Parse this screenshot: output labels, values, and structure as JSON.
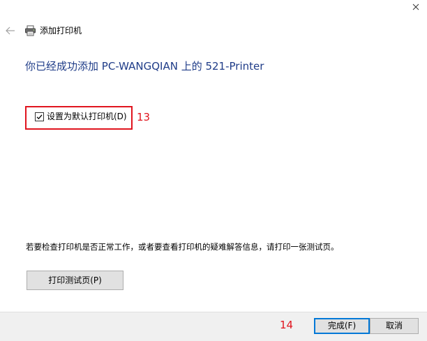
{
  "window": {
    "close_icon": "close-icon"
  },
  "header": {
    "back_icon": "back-arrow-icon",
    "printer_icon": "printer-icon",
    "title": "添加打印机"
  },
  "main": {
    "success_heading": "你已经成功添加 PC-WANGQIAN 上的 521-Printer",
    "default_printer_checkbox": {
      "label": "设置为默认打印机(D)",
      "checked": true
    },
    "info_text": "若要检查打印机是否正常工作，或者要查看打印机的疑难解答信息，请打印一张测试页。",
    "print_test_page_label": "打印测试页(P)"
  },
  "annotations": {
    "checkbox_marker": "13",
    "finish_marker": "14",
    "color": "#e0141e"
  },
  "footer": {
    "finish_label": "完成(F)",
    "cancel_label": "取消"
  },
  "colors": {
    "heading": "#1f3c88",
    "button_face": "#e1e1e1",
    "default_button_border": "#0078d7",
    "footer_bg": "#f0f0f0"
  }
}
